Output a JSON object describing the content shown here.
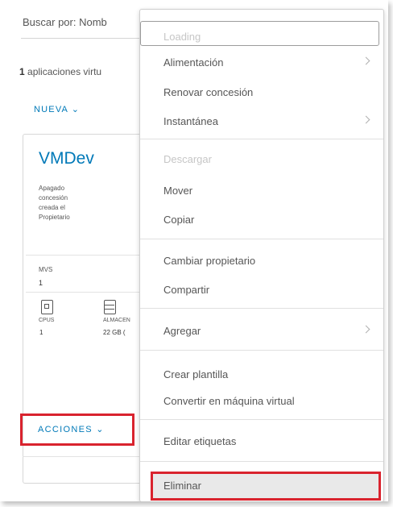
{
  "search": {
    "label": "Buscar por:",
    "field_value": "Nomb"
  },
  "vapps": {
    "count": "1",
    "text": "aplicaciones virtu"
  },
  "toolbar": {
    "new_label": "NUEVA ⌄"
  },
  "card": {
    "title": "VMDev",
    "props": [
      "Apagado",
      "concesión",
      "creada el",
      "Propietario"
    ],
    "vms_label": "MVS",
    "vms_value": "1",
    "cpus_label": "CPUS",
    "cpus_value": "1",
    "storage_label": "ALMACEN",
    "storage_value": "22 GB (",
    "actions_label": "ACCIONES ⌄"
  },
  "menu": {
    "items": [
      {
        "label": "Loading",
        "disabled": true
      },
      {
        "label": "Alimentación",
        "submenu": true
      },
      {
        "label": "Renovar concesión"
      },
      {
        "label": "Instantánea",
        "submenu": true
      },
      {
        "label": "Descargar",
        "disabled": true
      },
      {
        "label": "Mover"
      },
      {
        "label": "Copiar"
      },
      {
        "label": "Cambiar propietario"
      },
      {
        "label": "Compartir"
      },
      {
        "label": "Agregar",
        "submenu": true
      },
      {
        "label": "Crear plantilla"
      },
      {
        "label": "Convertir en máquina virtual"
      },
      {
        "label": "Editar etiquetas"
      },
      {
        "label": "Eliminar"
      }
    ]
  },
  "icons": {
    "cpu": "cpu-icon",
    "storage": "storage-icon",
    "chevron": "chevron-right-icon"
  },
  "colors": {
    "link": "#0079b8",
    "highlight_border": "#d9232e",
    "disabled_text": "#c6c6c6"
  }
}
